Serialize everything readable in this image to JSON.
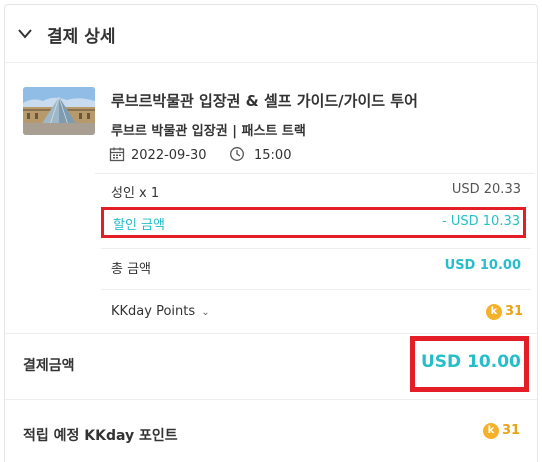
{
  "header": {
    "title": "결제 상세",
    "icon": "chevron-down-icon"
  },
  "product": {
    "title": "루브르박물관 입장권 & 셀프 가이드/가이드 투어",
    "option": "루브르 박물관 입장권 | 패스트 트랙",
    "date": "2022-09-30",
    "time": "15:00"
  },
  "summary": {
    "adult_label": "성인 x 1",
    "adult_value": "USD 20.33",
    "discount_label": "할인 금액",
    "discount_value": "- USD 10.33",
    "total_label": "총 금액",
    "total_value": "USD 10.00",
    "points_label": "KKday Points",
    "points_value": "31"
  },
  "payment": {
    "label": "결제금액",
    "value": "USD 10.00"
  },
  "earn": {
    "label": "적립 예정 KKday 포인트",
    "value": "31"
  },
  "colors": {
    "accent": "#26bec9",
    "highlight_border": "#e31e26",
    "coin": "#f5b12a"
  }
}
